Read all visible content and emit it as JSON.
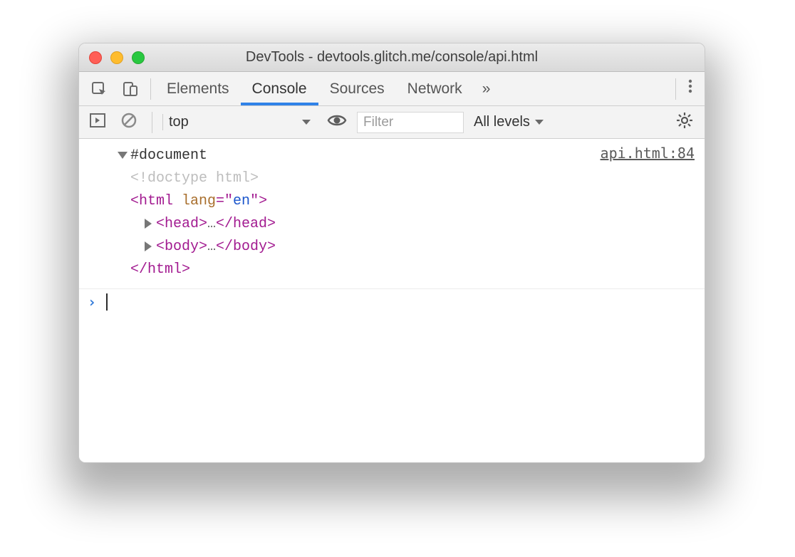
{
  "window": {
    "title_prefix": "DevTools - ",
    "title_path": "devtools.glitch.me/console/api.html"
  },
  "tabs": {
    "elements": "Elements",
    "console": "Console",
    "sources": "Sources",
    "network": "Network",
    "more": "»"
  },
  "filterbar": {
    "context": "top",
    "filter_placeholder": "Filter",
    "levels": "All levels"
  },
  "log": {
    "source_link": "api.html:84",
    "document_label": "#document",
    "doctype_text": "<!doctype html>",
    "html_open_prefix": "<html ",
    "html_attr_name": "lang",
    "html_attr_eq": "=\"",
    "html_attr_value": "en",
    "html_attr_close": "\">",
    "head_open": "<head>",
    "head_close": "</head>",
    "body_open": "<body>",
    "body_close": "</body>",
    "html_close": "</html>",
    "ellipsis": "…"
  },
  "prompt": {
    "caret": "›"
  }
}
